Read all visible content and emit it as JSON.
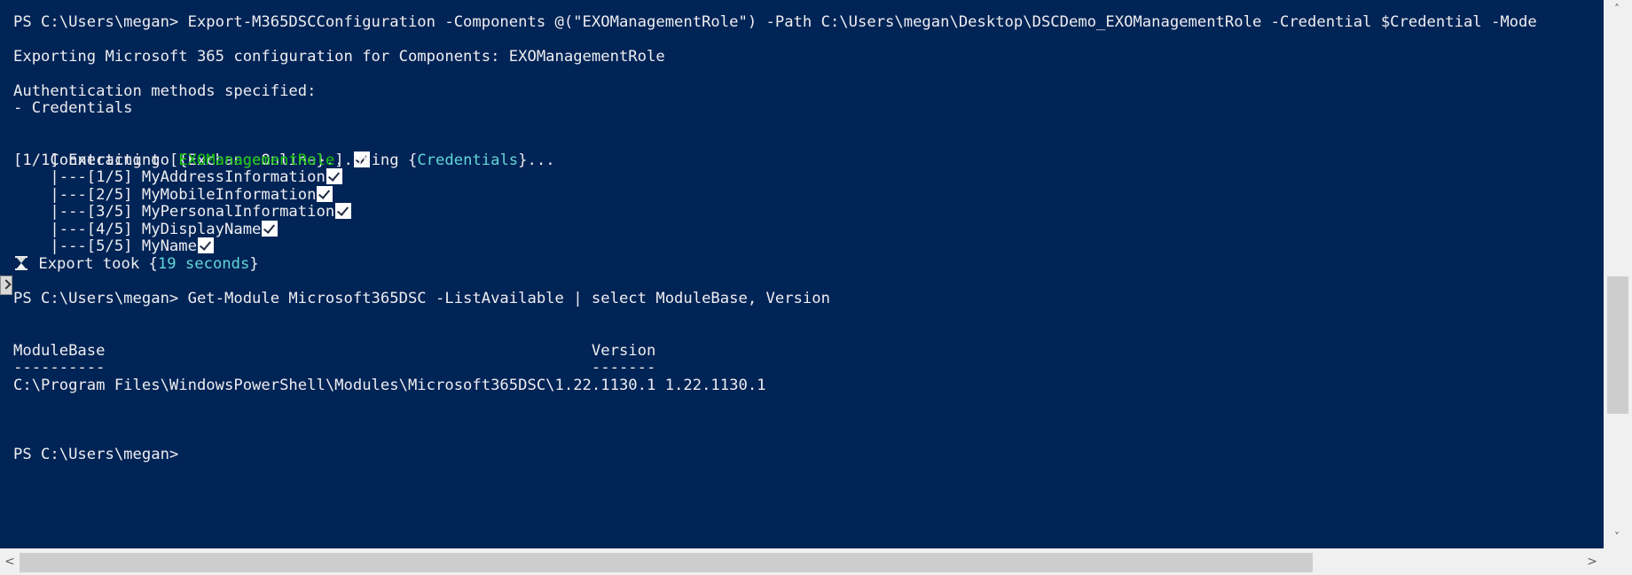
{
  "console": {
    "colors": {
      "background": "#012456",
      "text": "#eeedf0",
      "green": "#16c60c",
      "cyan": "#3a96dd"
    },
    "lines": {
      "l1": "PS C:\\Users\\megan> Export-M365DSCConfiguration -Components @(\"EXOManagementRole\") -Path C:\\Users\\megan\\Desktop\\DSCDemo_EXOManagementRole -Credential $Credential -Mode",
      "l2": "Exporting Microsoft 365 configuration for Components: EXOManagementRole",
      "l3": "Authentication methods specified:",
      "l4": "- Credentials",
      "l5": "Connecting to {ExchangeOnline}...",
      "l6_pre": "[1/1] Extracting [",
      "l6_role": "EXOManagementRole",
      "l6_mid": "] using {",
      "l6_cred": "Credentials",
      "l6_post": "}...",
      "l7": "    |---[1/5] MyAddressInformation",
      "l8": "    |---[2/5] MyMobileInformation",
      "l9": "    |---[3/5] MyPersonalInformation",
      "l10": "    |---[4/5] MyDisplayName",
      "l11": "    |---[5/5] MyName",
      "l12_pre": " Export took {",
      "l12_time": "19 seconds",
      "l12_post": "}",
      "l13": "PS C:\\Users\\megan> Get-Module Microsoft365DSC -ListAvailable | select ModuleBase, Version",
      "l14": "ModuleBase                                                     Version",
      "l15": "----------                                                     -------",
      "l16": "C:\\Program Files\\WindowsPowerShell\\Modules\\Microsoft365DSC\\1.22.1130.1 1.22.1130.1",
      "l17": "PS C:\\Users\\megan>"
    },
    "icons": {
      "check": "checkmark-icon",
      "hourglass": "hourglass-icon"
    }
  },
  "scrollbar": {
    "up": "˄",
    "down": "˅",
    "left": "<",
    "right": ">"
  }
}
